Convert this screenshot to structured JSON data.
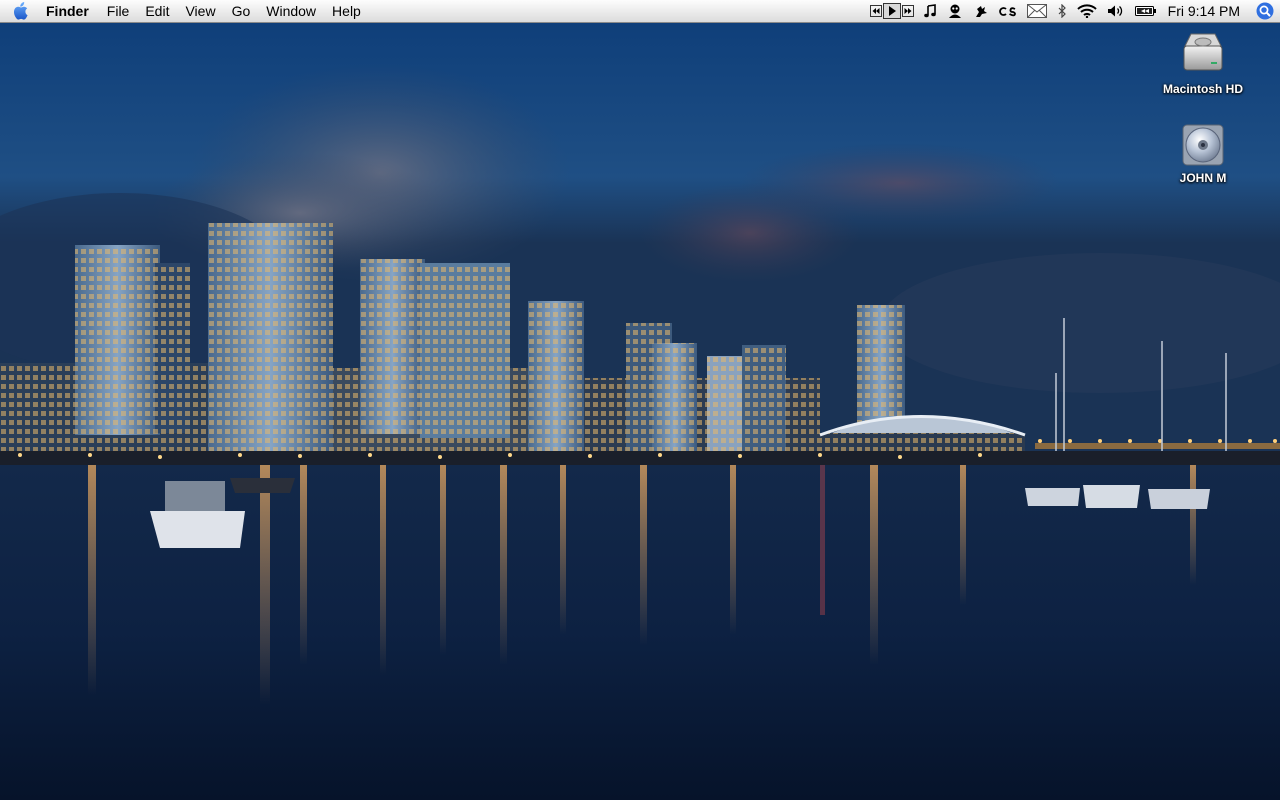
{
  "menubar": {
    "apple_icon": "apple-logo-icon",
    "app_name": "Finder",
    "menus": [
      "File",
      "Edit",
      "View",
      "Go",
      "Window",
      "Help"
    ],
    "extras": [
      {
        "name": "media-previous-icon"
      },
      {
        "name": "media-play-icon"
      },
      {
        "name": "media-next-icon"
      },
      {
        "name": "music-note-icon"
      },
      {
        "name": "chat-status-icon"
      },
      {
        "name": "growl-paw-icon"
      },
      {
        "name": "lastfm-icon"
      },
      {
        "name": "mail-icon"
      },
      {
        "name": "bluetooth-icon"
      },
      {
        "name": "wifi-icon"
      },
      {
        "name": "volume-icon"
      },
      {
        "name": "battery-icon"
      }
    ],
    "clock": "Fri 9:14 PM",
    "spotlight_icon": "spotlight-icon",
    "colors": {
      "spotlight": "#2f6fe0"
    }
  },
  "desktop": {
    "icons": [
      {
        "label": "Macintosh HD",
        "icon": "hard-drive-icon"
      },
      {
        "label": "JOHN M",
        "icon": "cd-disc-icon"
      }
    ]
  }
}
